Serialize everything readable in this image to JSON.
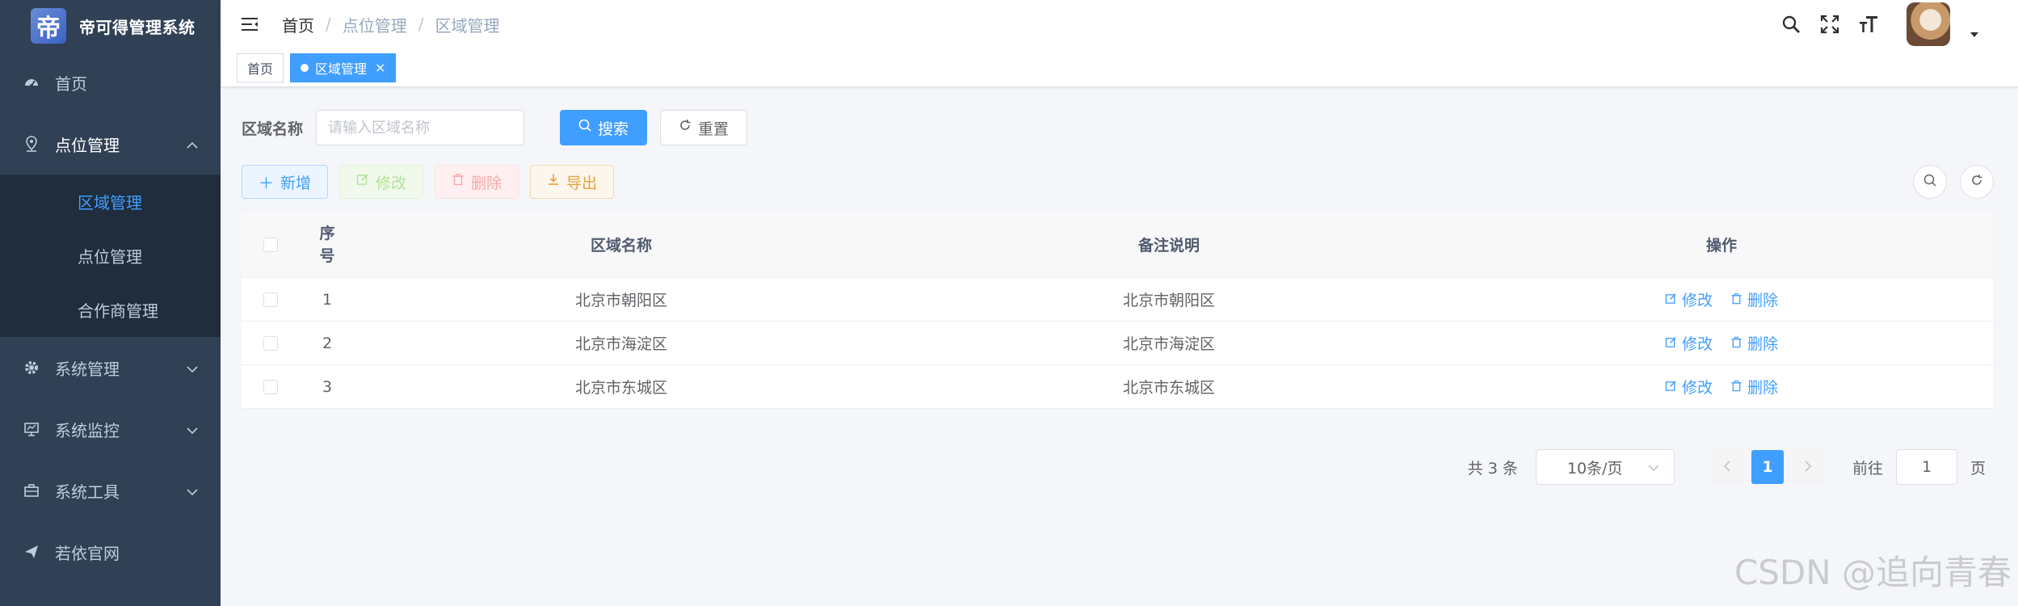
{
  "app": {
    "title": "帝可得管理系统",
    "logo_char": "帝"
  },
  "sidebar": {
    "items": [
      {
        "label": "首页",
        "icon": "dashboard-icon"
      },
      {
        "label": "点位管理",
        "icon": "location-icon",
        "expanded": true,
        "children": [
          {
            "label": "区域管理",
            "active": true
          },
          {
            "label": "点位管理"
          },
          {
            "label": "合作商管理"
          }
        ]
      },
      {
        "label": "系统管理",
        "icon": "gear-icon"
      },
      {
        "label": "系统监控",
        "icon": "monitor-icon"
      },
      {
        "label": "系统工具",
        "icon": "toolbox-icon"
      },
      {
        "label": "若依官网",
        "icon": "send-icon"
      }
    ]
  },
  "breadcrumb": {
    "home": "首页",
    "sep": "/",
    "level1": "点位管理",
    "level2": "区域管理"
  },
  "tags": {
    "home": "首页",
    "active": "区域管理"
  },
  "search": {
    "label": "区域名称",
    "placeholder": "请输入区域名称",
    "search_button": "搜索",
    "reset_button": "重置"
  },
  "toolbar": {
    "add": "新增",
    "edit": "修改",
    "delete": "删除",
    "export": "导出"
  },
  "table": {
    "headers": {
      "index_top": "序",
      "index_bottom": "号",
      "name": "区域名称",
      "remark": "备注说明",
      "ops": "操作"
    },
    "rows": [
      {
        "index": "1",
        "name": "北京市朝阳区",
        "remark": "北京市朝阳区"
      },
      {
        "index": "2",
        "name": "北京市海淀区",
        "remark": "北京市海淀区"
      },
      {
        "index": "3",
        "name": "北京市东城区",
        "remark": "北京市东城区"
      }
    ],
    "row_edit": "修改",
    "row_delete": "删除"
  },
  "pagination": {
    "total": "共 3 条",
    "page_size": "10条/页",
    "current": "1",
    "goto_label": "前往",
    "goto_value": "1",
    "goto_suffix": "页"
  },
  "watermark": "CSDN @追向青春",
  "colors": {
    "sidebar_bg": "#304156",
    "submenu_bg": "#1f2d3d",
    "primary": "#409eff"
  }
}
